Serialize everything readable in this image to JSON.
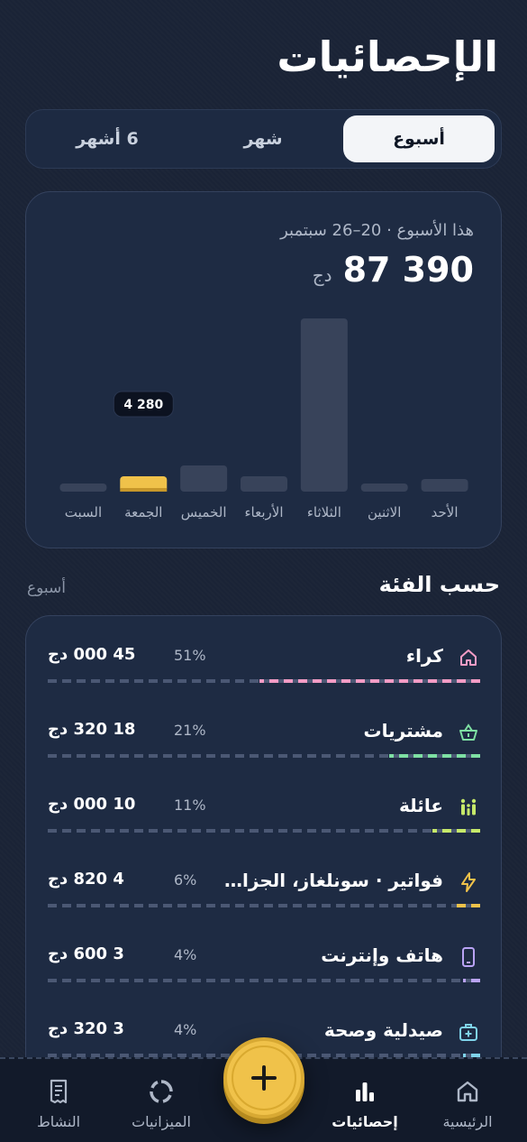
{
  "page": {
    "title": "الإحصائيات"
  },
  "tabs": [
    {
      "label": "أسبوع",
      "active": true
    },
    {
      "label": "شهر",
      "active": false
    },
    {
      "label": "6 أشهر",
      "active": false
    }
  ],
  "summary": {
    "range_label": "هذا الأسبوع · 20–26 سبتمبر",
    "total": "87 390",
    "currency": "دج"
  },
  "chart_data": {
    "type": "bar",
    "categories": [
      "الأحد",
      "الاثنين",
      "الثلاثاء",
      "الأربعاء",
      "الخميس",
      "الجمعة",
      "السبت"
    ],
    "values": [
      1400,
      900,
      19200,
      1700,
      2900,
      1700,
      900
    ],
    "highlighted_index": 5,
    "tooltip": "4 280",
    "colors": {
      "bar": "#38435a",
      "highlight": "#f0c24a"
    }
  },
  "categories_section": {
    "heading": "حسب الفئة",
    "period": "أسبوع",
    "items": [
      {
        "name": "كراء",
        "percent": "51%",
        "amount": "45 000 دج",
        "share": 0.51,
        "color": "#f39cc5",
        "icon": "home-icon"
      },
      {
        "name": "مشتريات",
        "percent": "21%",
        "amount": "18 320 دج",
        "share": 0.21,
        "color": "#7ee0a3",
        "icon": "basket-icon"
      },
      {
        "name": "عائلة",
        "percent": "11%",
        "amount": "10 000 دج",
        "share": 0.11,
        "color": "#c6e96a",
        "icon": "family-icon"
      },
      {
        "name": "فواتير · سونلغاز، الجزائرية للمياه",
        "percent": "6%",
        "amount": "4 820 دج",
        "share": 0.06,
        "color": "#f0c24a",
        "icon": "bolt-icon"
      },
      {
        "name": "هاتف وإنترنت",
        "percent": "4%",
        "amount": "3 600 دج",
        "share": 0.04,
        "color": "#b9a3f5",
        "icon": "phone-icon"
      },
      {
        "name": "صيدلية وصحة",
        "percent": "4%",
        "amount": "3 320 دج",
        "share": 0.04,
        "color": "#7fd3ea",
        "icon": "medkit-icon"
      }
    ]
  },
  "nav": {
    "home": "الرئيسية",
    "stats": "إحصائيات",
    "budgets": "الميزانيات",
    "activity": "النشاط"
  }
}
